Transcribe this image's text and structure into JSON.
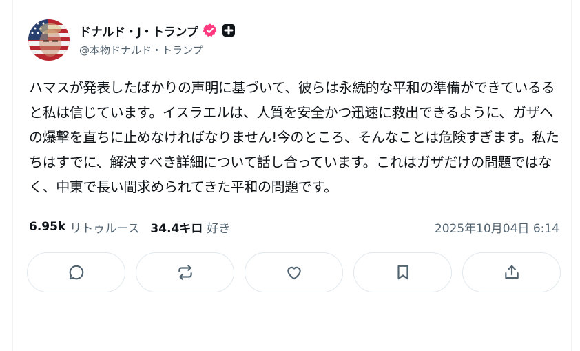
{
  "author": {
    "display_name": "ドナルド・J・トランプ",
    "handle": "@本物ドナルド・トランプ"
  },
  "post": {
    "text": "ハマスが発表したばかりの声明に基づいて、彼らは永続的な平和の準備ができているると私は信じています。イスラエルは、人質を安全かつ迅速に救出できるように、ガザへの爆撃を直ちに止めなければなりません!今のところ、そんなことは危険すぎます。私たちはすでに、解決すべき詳細について話し合っています。これはガザだけの問題ではなく、中東で長い間求められてきた平和の問題です。"
  },
  "stats": {
    "retruths_count": "6.95k",
    "retruths_label": "リトゥルース",
    "likes_count": "34.4キロ",
    "likes_label": "好き",
    "timestamp": "2025年10月04日 6:14"
  },
  "icons": {
    "verified": "verified-badge-icon",
    "affiliation": "plus-badge-icon",
    "reply": "reply-icon",
    "repost": "repost-icon",
    "like": "heart-icon",
    "bookmark": "bookmark-icon",
    "share": "share-icon"
  },
  "colors": {
    "verified": "#ff3b7f",
    "muted_text": "#536471",
    "border": "#e1e8ed"
  }
}
